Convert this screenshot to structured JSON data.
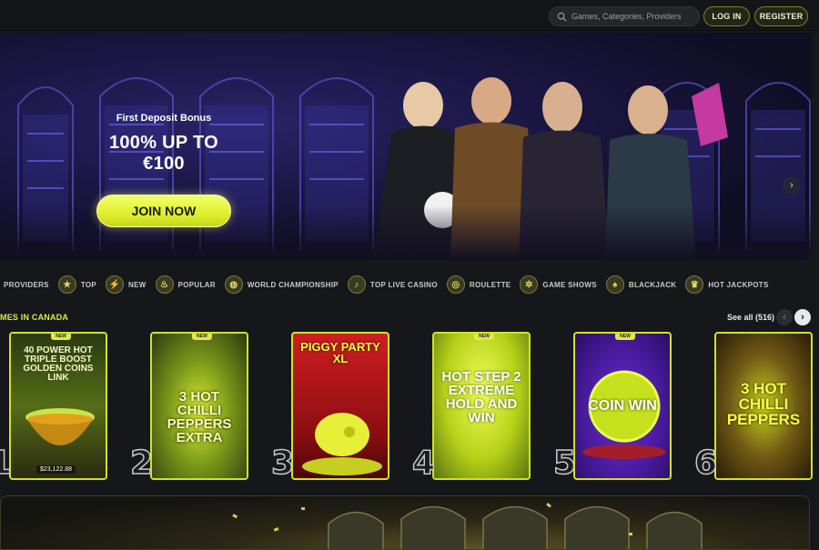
{
  "header": {
    "search_placeholder": "Games, Categories, Providers",
    "login_label": "LOG IN",
    "register_label": "REGISTER"
  },
  "hero": {
    "subtitle": "First Deposit Bonus",
    "title": "100% UP TO €100",
    "cta_label": "JOIN NOW",
    "slides_total": 2,
    "active_slide": 2
  },
  "categories": [
    {
      "label": "PROVIDERS",
      "icon": "providers-icon"
    },
    {
      "label": "TOP",
      "icon": "star-icon"
    },
    {
      "label": "NEW",
      "icon": "lightning-icon"
    },
    {
      "label": "POPULAR",
      "icon": "flame-icon"
    },
    {
      "label": "WORLD CHAMPIONSHIP",
      "icon": "ball-icon"
    },
    {
      "label": "TOP LIVE CASINO",
      "icon": "microphone-icon"
    },
    {
      "label": "ROULETTE",
      "icon": "roulette-icon"
    },
    {
      "label": "GAME SHOWS",
      "icon": "wheel-icon"
    },
    {
      "label": "BLACKJACK",
      "icon": "cards-icon"
    },
    {
      "label": "HOT JACKPOTS",
      "icon": "jackpot-icon"
    }
  ],
  "section": {
    "title": "MES IN CANADA",
    "see_all_label": "See all (516)"
  },
  "games": [
    {
      "rank": "1",
      "name": "40 POWER HOT TRIPLE BOOST GOLDEN COINS LINK",
      "badge": "NEW",
      "jackpot": "$23,122.88"
    },
    {
      "rank": "2",
      "name": "3 HOT CHILLI PEPPERS EXTRA",
      "badge": "NEW",
      "jackpot": ""
    },
    {
      "rank": "3",
      "name": "PIGGY PARTY XL",
      "badge": "",
      "jackpot": ""
    },
    {
      "rank": "4",
      "name": "HOT STEP 2 EXTREME HOLD AND WIN",
      "badge": "NEW",
      "jackpot": ""
    },
    {
      "rank": "5",
      "name": "COIN WIN",
      "badge": "NEW",
      "jackpot": ""
    },
    {
      "rank": "6",
      "name": "3 HOT CHILLI PEPPERS",
      "badge": "",
      "jackpot": ""
    }
  ],
  "colors": {
    "accent": "#dfe94a",
    "background": "#16171b"
  }
}
